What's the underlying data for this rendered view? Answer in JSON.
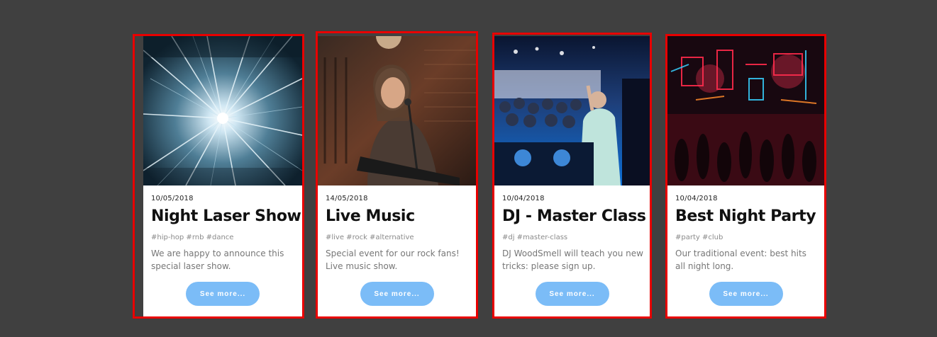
{
  "cards": [
    {
      "date": "10/05/2018",
      "title": "Night Laser Show",
      "tags": "#hip-hop #rnb #dance",
      "description": "We are happy to announce this special laser show.",
      "button_label": "See more..."
    },
    {
      "date": "14/05/2018",
      "title": "Live Music",
      "tags": "#live #rock #alternative",
      "description": "Special event for our rock fans! Live music show.",
      "button_label": "See more..."
    },
    {
      "date": "10/04/2018",
      "title": "DJ - Master Class",
      "tags": "#dj #master-class",
      "description": "DJ WoodSmell will teach you new tricks: please sign up.",
      "button_label": "See more..."
    },
    {
      "date": "10/04/2018",
      "title": "Best Night Party",
      "tags": "#party #club",
      "description": "Our traditional event: best hits all night long.",
      "button_label": "See more..."
    }
  ],
  "colors": {
    "page_background": "#404040",
    "card_border": "#e80000",
    "button": "#7bbcf7",
    "title_text": "#111111",
    "body_text": "#777777"
  }
}
